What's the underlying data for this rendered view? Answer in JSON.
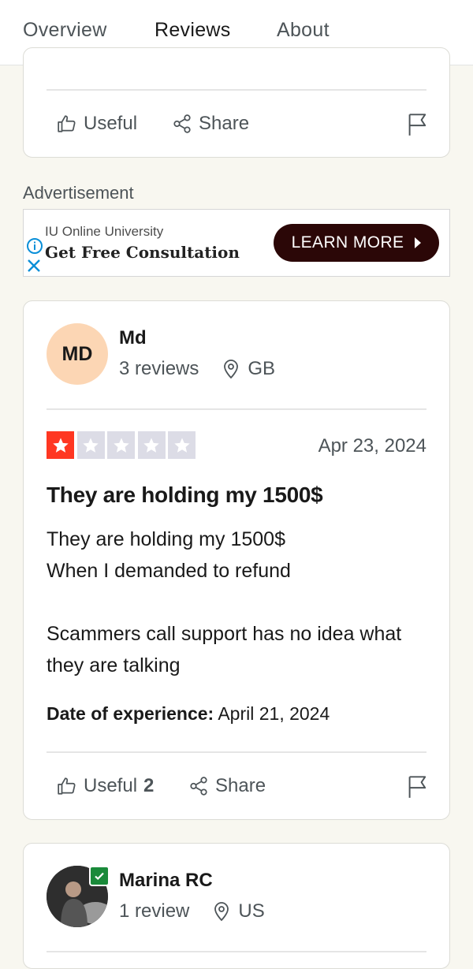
{
  "tabs": [
    {
      "label": "Overview",
      "active": false
    },
    {
      "label": "Reviews",
      "active": true
    },
    {
      "label": "About",
      "active": false
    }
  ],
  "previous_card": {
    "useful_label": "Useful",
    "share_label": "Share"
  },
  "ad": {
    "label": "Advertisement",
    "sponsor": "IU Online University",
    "headline": "Get Free Consultation",
    "cta": "LEARN MORE"
  },
  "review_md": {
    "avatar_initials": "MD",
    "name": "Md",
    "reviews_count": "3 reviews",
    "country": "GB",
    "rating": 1,
    "max_rating": 5,
    "date": "Apr 23, 2024",
    "title": "They are holding my 1500$",
    "body": "They are holding my 1500$\nWhen I demanded to refund\n\nScammers call support has no idea what they are talking",
    "experience_label": "Date of experience:",
    "experience_date": "April 21, 2024",
    "useful_label": "Useful",
    "useful_count": "2",
    "share_label": "Share"
  },
  "review_marina": {
    "name": "Marina RC",
    "reviews_count": "1 review",
    "country": "US"
  },
  "colors": {
    "star_active": "#ff3722",
    "star_inactive": "#dcdce6",
    "avatar_bg": "#fcd6b4",
    "cta_bg": "#2b0707",
    "tab_underline": "#1b1b36",
    "verified": "#1a8a3a"
  }
}
